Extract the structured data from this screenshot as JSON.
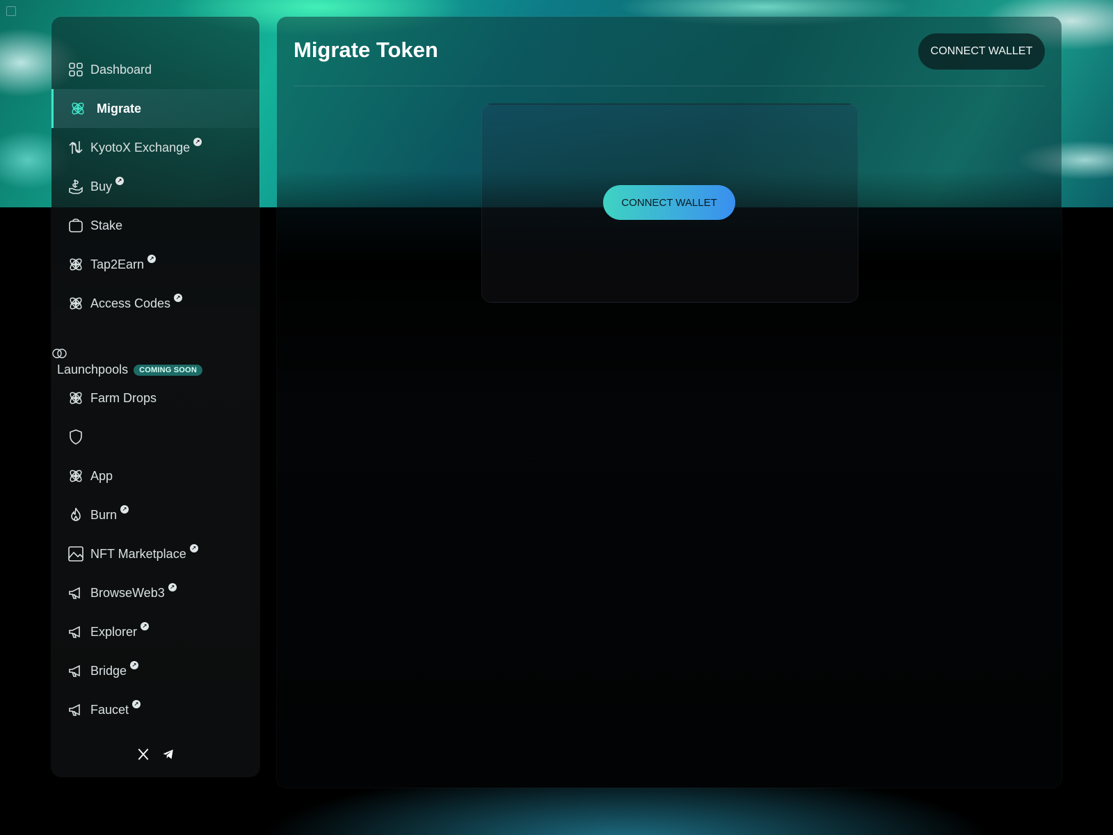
{
  "sidebar": {
    "items": [
      {
        "label": "Dashboard",
        "icon": "grid-icon",
        "external": false
      },
      {
        "label": "Migrate",
        "icon": "atom-icon",
        "external": false,
        "active": true
      },
      {
        "label": "KyotoX Exchange",
        "icon": "swap-arrows-icon",
        "external": true
      },
      {
        "label": "Buy",
        "icon": "hand-coin-icon",
        "external": true
      },
      {
        "label": "Stake",
        "icon": "bag-icon",
        "external": false
      },
      {
        "label": "Tap2Earn",
        "icon": "atom-icon",
        "external": true
      },
      {
        "label": "Access Codes",
        "icon": "atom-icon",
        "external": true
      }
    ],
    "section": {
      "title": "Launchpools",
      "badge": "COMING SOON",
      "toggle_icon": "toggle-icon"
    },
    "section_items": [
      {
        "label": "Farm Drops",
        "icon": "atom-icon",
        "external": false
      },
      {
        "label": "",
        "icon": "shield-icon",
        "external": false
      },
      {
        "label": "App",
        "icon": "atom-icon",
        "external": false
      },
      {
        "label": "Burn",
        "icon": "flame-icon",
        "external": true
      },
      {
        "label": "NFT Marketplace",
        "icon": "image-icon",
        "external": true
      },
      {
        "label": "BrowseWeb3",
        "icon": "megaphone-icon",
        "external": true
      },
      {
        "label": "Explorer",
        "icon": "megaphone-icon",
        "external": true
      },
      {
        "label": "Bridge",
        "icon": "megaphone-icon",
        "external": true
      },
      {
        "label": "Faucet",
        "icon": "megaphone-icon",
        "external": true
      }
    ],
    "social": [
      "x-icon",
      "telegram-icon"
    ]
  },
  "header": {
    "title": "Migrate Token",
    "connect_label": "CONNECT WALLET"
  },
  "card": {
    "connect_label": "CONNECT WALLET"
  },
  "colors": {
    "accent": "#3ee6c8",
    "button_gradient_start": "#3fd3c2",
    "button_gradient_end": "#3a8ff0",
    "badge_bg": "#1d6b66"
  }
}
